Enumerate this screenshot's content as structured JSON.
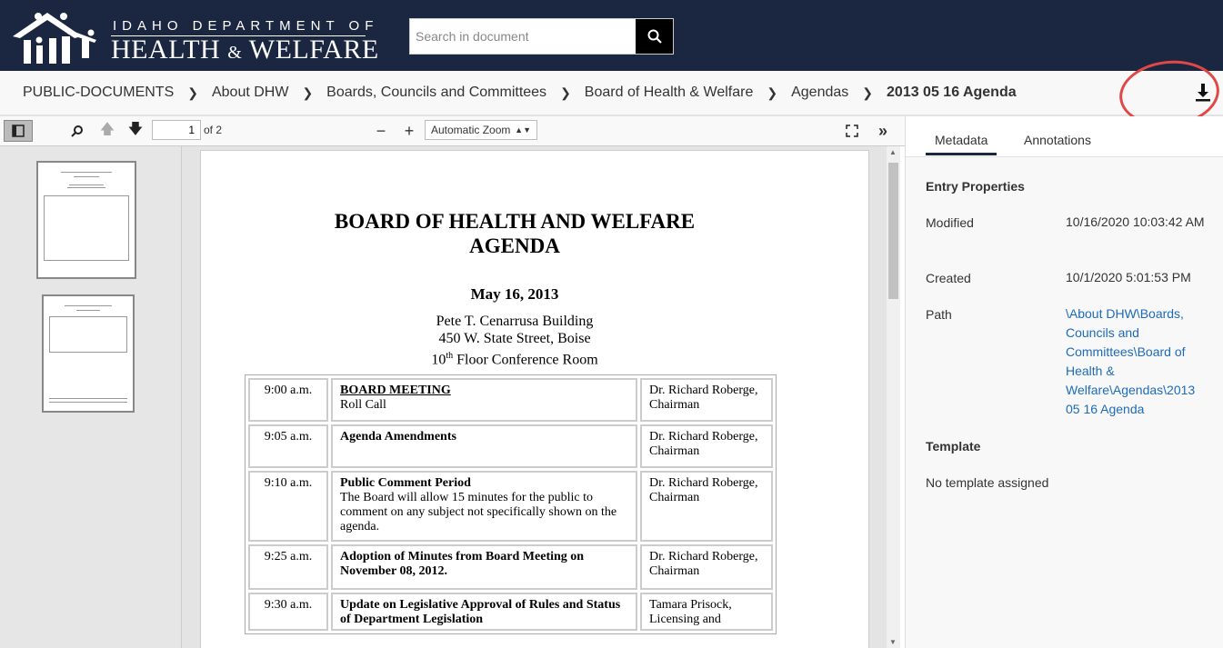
{
  "header": {
    "brand_top": "IDAHO DEPARTMENT OF",
    "brand_main_1": "HEALTH",
    "brand_amp": "&",
    "brand_main_2": "WELFARE",
    "search_placeholder": "Search in document"
  },
  "breadcrumb": [
    "PUBLIC-DOCUMENTS",
    "About DHW",
    "Boards, Councils and Committees",
    "Board of Health & Welfare",
    "Agendas",
    "2013 05 16 Agenda"
  ],
  "toolbar": {
    "page": "1",
    "page_of": "of 2",
    "zoom": "Automatic Zoom"
  },
  "document": {
    "title_1": "BOARD OF HEALTH AND WELFARE",
    "title_2": "AGENDA",
    "date": "May 16, 2013",
    "addr_1": "Pete T. Cenarrusa Building",
    "addr_2": "450 W. State Street, Boise",
    "addr_3_num": "10",
    "addr_3_sup": "th",
    "addr_3_rest": " Floor Conference Room",
    "rows": [
      {
        "time": "9:00 a.m.",
        "title": "BOARD MEETING",
        "desc": "Roll Call",
        "presenter": "Dr. Richard Roberge, Chairman"
      },
      {
        "time": "9:05 a.m.",
        "title": "Agenda Amendments",
        "desc": "",
        "presenter": "Dr. Richard Roberge, Chairman"
      },
      {
        "time": "9:10 a.m.",
        "title": "Public Comment Period",
        "desc": "The Board will allow 15 minutes for the public to comment on any subject not specifically shown on the agenda.",
        "presenter": "Dr. Richard Roberge, Chairman"
      },
      {
        "time": "9:25 a.m.",
        "title": "Adoption of Minutes from Board Meeting on November 08, 2012.",
        "desc": "",
        "presenter": "Dr. Richard Roberge, Chairman"
      },
      {
        "time": "9:30 a.m.",
        "title": "Update on Legislative Approval of Rules and Status of Department Legislation",
        "desc": "",
        "presenter": "Tamara Prisock, Licensing and"
      }
    ]
  },
  "panel": {
    "tabs": [
      "Metadata",
      "Annotations"
    ],
    "entry_properties": "Entry Properties",
    "modified_label": "Modified",
    "modified": "10/16/2020 10:03:42 AM",
    "created_label": "Created",
    "created": "10/1/2020 5:01:53 PM",
    "path_label": "Path",
    "path": "\\About DHW\\Boards, Councils and Committees\\Board of Health & Welfare\\Agendas\\2013 05 16 Agenda",
    "template_label": "Template",
    "template": "No template assigned"
  }
}
